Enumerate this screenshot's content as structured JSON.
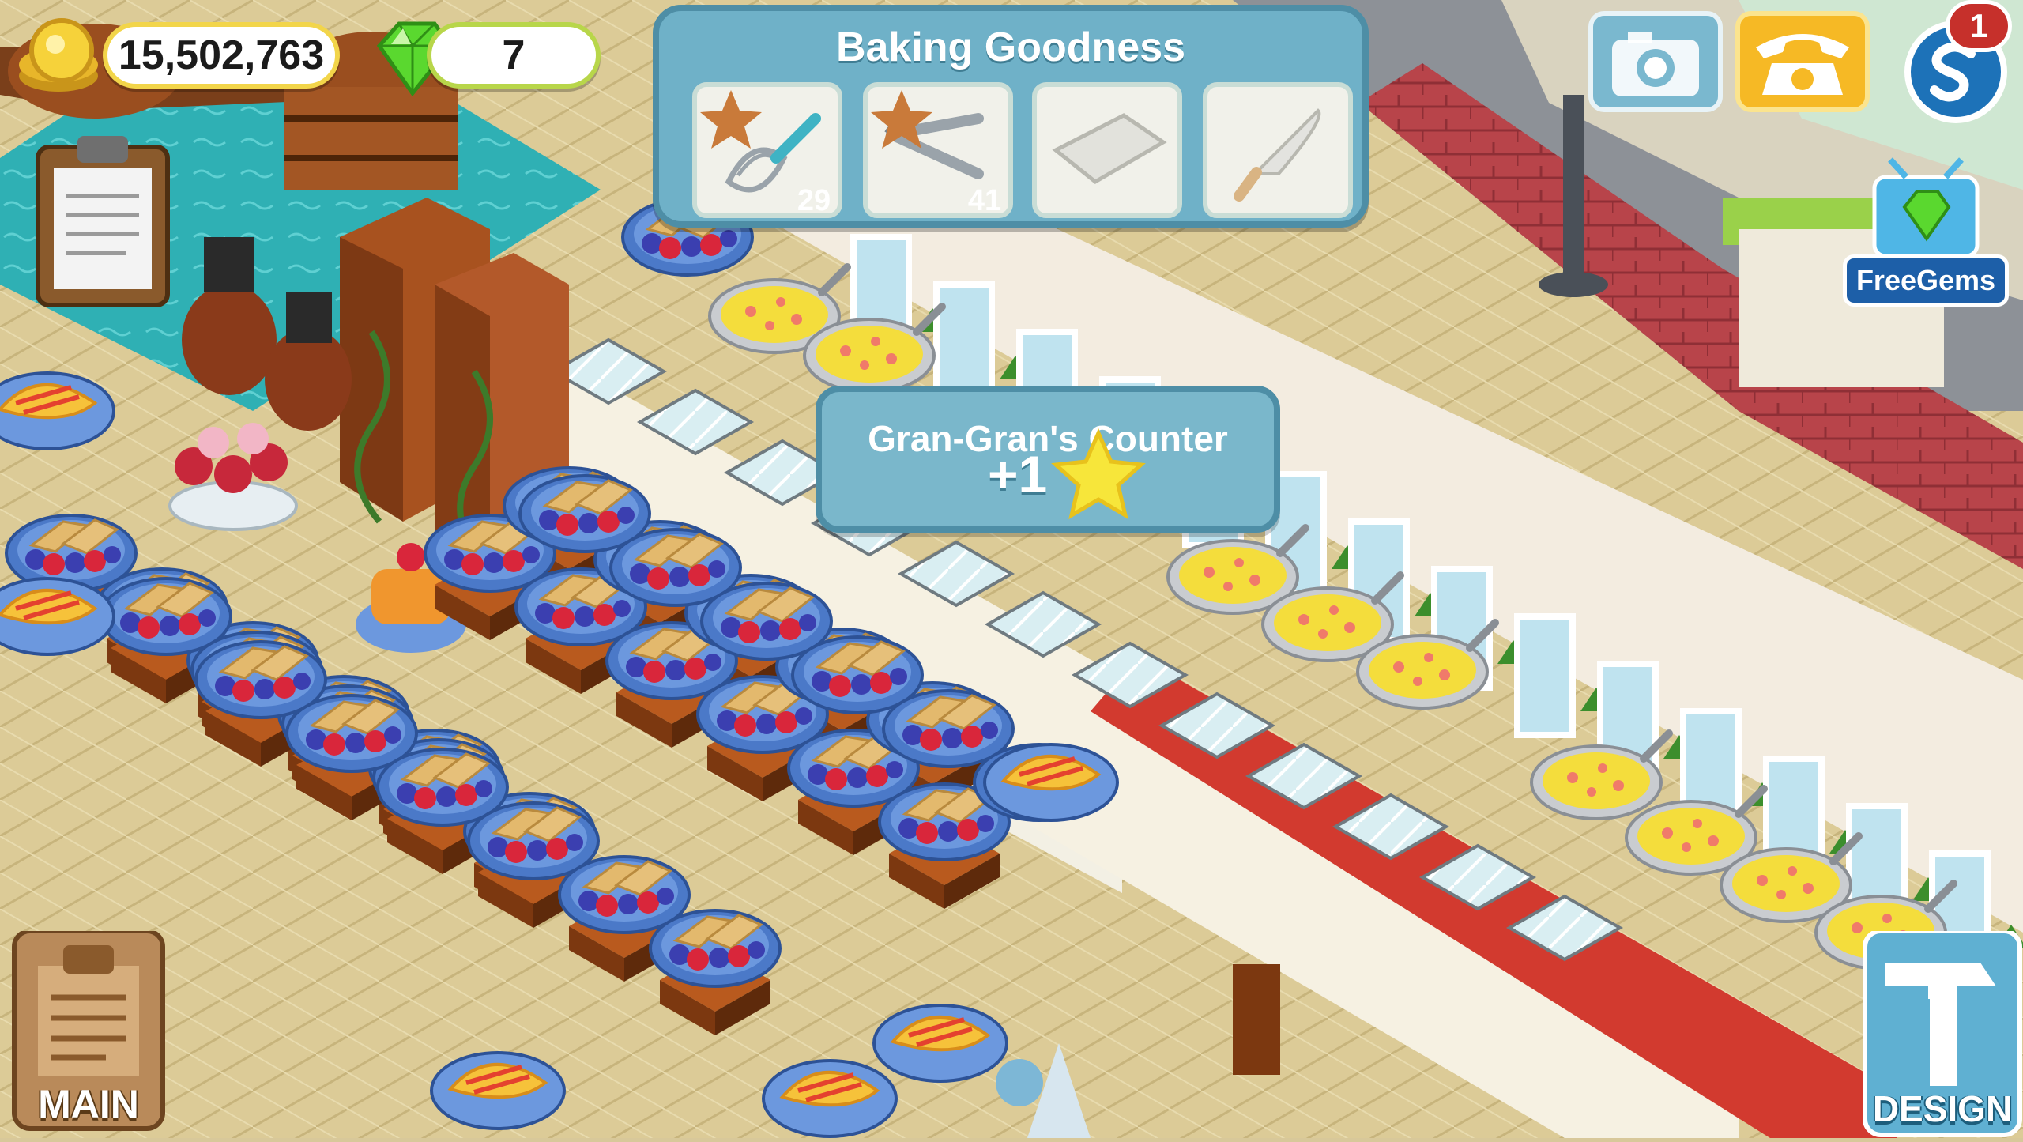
{
  "hud": {
    "coins": "15,502,763",
    "gems": "7",
    "coin_icon": "gold-coins-icon",
    "gem_icon": "green-gem-icon"
  },
  "popup": {
    "title": "Baking Goodness",
    "slots": [
      {
        "icon": "whisk-icon",
        "count": "29"
      },
      {
        "icon": "tongs-icon",
        "count": "41"
      },
      {
        "icon": "baking-tray-icon",
        "count": ""
      },
      {
        "icon": "knife-icon",
        "count": ""
      }
    ]
  },
  "toast": {
    "title": "Gran-Gran's Counter",
    "reward": "+1"
  },
  "buttons": {
    "notification_count": "1",
    "free_gems": "FreeGems",
    "main": "MAIN",
    "design": "DESIGN"
  },
  "colors": {
    "panel": "#6fb1c8",
    "panel_border": "#4e8ea6",
    "coin_border": "#f2d54a",
    "gem_border": "#b8d64a",
    "red_carpet": "#d23a2f"
  }
}
